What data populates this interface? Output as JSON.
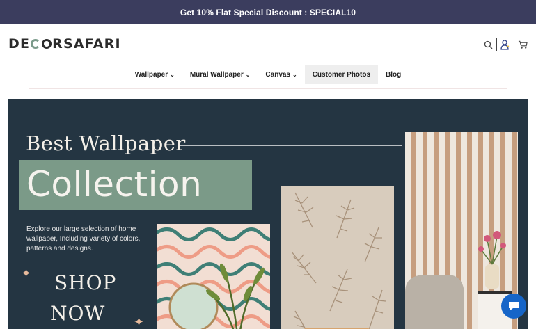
{
  "promo": {
    "text": "Get 10% Flat Special Discount : SPECIAL10"
  },
  "header": {
    "logo_parts": [
      "DE",
      "RSAFARI"
    ],
    "icons": [
      "search-icon",
      "user-icon",
      "cart-icon"
    ]
  },
  "nav": {
    "items": [
      {
        "label": "Wallpaper",
        "dropdown": true
      },
      {
        "label": "Mural Wallpaper",
        "dropdown": true
      },
      {
        "label": "Canvas",
        "dropdown": true
      },
      {
        "label": "Customer Photos",
        "dropdown": false,
        "active": true
      },
      {
        "label": "Blog",
        "dropdown": false
      }
    ]
  },
  "hero": {
    "title_line1": "Best Wallpaper",
    "title_line2": "Collection",
    "description": "Explore our large selection of home wallpaper, Including variety of colors, patterns and designs.",
    "cta_line1": "SHOP",
    "cta_line2": "NOW"
  },
  "colors": {
    "promo_bg": "#3b3d5e",
    "hero_bg": "#243542",
    "hero_accent": "#7b9a88",
    "chat_button": "#1665c8"
  }
}
